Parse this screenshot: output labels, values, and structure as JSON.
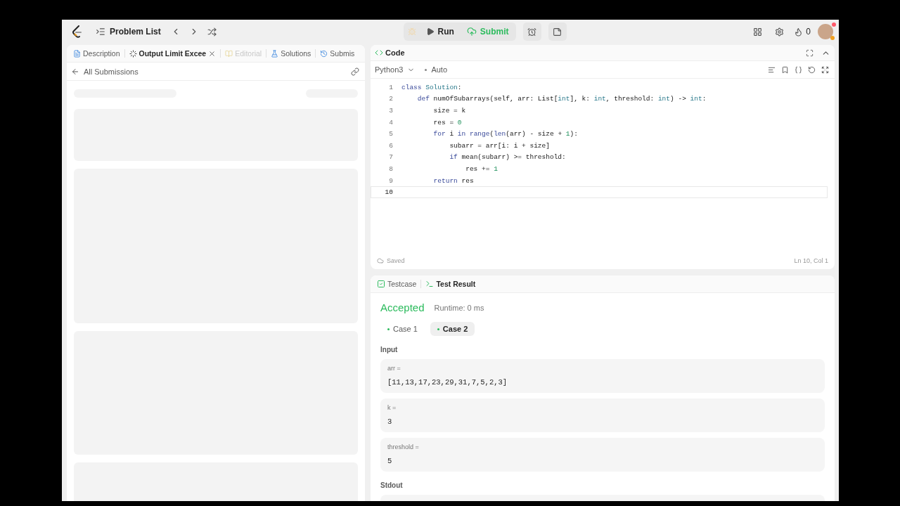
{
  "header": {
    "problem_list": "Problem List",
    "run": "Run",
    "submit": "Submit",
    "streak": "0"
  },
  "left_panel": {
    "tabs": [
      {
        "kind": "description",
        "label": "Description",
        "selected": false,
        "disabled": false,
        "closable": false
      },
      {
        "kind": "result",
        "label": "Output Limit Excee",
        "selected": true,
        "disabled": false,
        "closable": true
      },
      {
        "kind": "editorial",
        "label": "Editorial",
        "selected": false,
        "disabled": true,
        "closable": false
      },
      {
        "kind": "solutions",
        "label": "Solutions",
        "selected": false,
        "disabled": false,
        "closable": false
      },
      {
        "kind": "submissions",
        "label": "Submis",
        "selected": false,
        "disabled": false,
        "closable": false
      }
    ],
    "back_link": "All Submissions"
  },
  "code_panel": {
    "title": "Code",
    "language": "Python3",
    "mode": "Auto",
    "lines": [
      {
        "number": "1",
        "current": false,
        "tokens": [
          {
            "kind": "keyword",
            "text": "class"
          },
          {
            "kind": "type",
            "text": " Solution"
          },
          {
            "kind": "plain",
            "text": ":"
          }
        ]
      },
      {
        "number": "2",
        "current": false,
        "tokens": [
          {
            "kind": "keyword",
            "text": "    def"
          },
          {
            "kind": "plain",
            "text": " numOfSubarrays(self, arr: List["
          },
          {
            "kind": "type",
            "text": "int"
          },
          {
            "kind": "plain",
            "text": "], k: "
          },
          {
            "kind": "type",
            "text": "int"
          },
          {
            "kind": "plain",
            "text": ", threshold: "
          },
          {
            "kind": "type",
            "text": "int"
          },
          {
            "kind": "plain",
            "text": ") -> "
          },
          {
            "kind": "type",
            "text": "int"
          },
          {
            "kind": "plain",
            "text": ":"
          }
        ]
      },
      {
        "number": "3",
        "current": false,
        "tokens": [
          {
            "kind": "plain",
            "text": "        size = k"
          }
        ]
      },
      {
        "number": "4",
        "current": false,
        "tokens": [
          {
            "kind": "plain",
            "text": "        res = "
          },
          {
            "kind": "number",
            "text": "0"
          }
        ]
      },
      {
        "number": "5",
        "current": false,
        "tokens": [
          {
            "kind": "keyword",
            "text": "        for"
          },
          {
            "kind": "plain",
            "text": " i "
          },
          {
            "kind": "keyword",
            "text": "in"
          },
          {
            "kind": "builtin",
            "text": " range"
          },
          {
            "kind": "plain",
            "text": "("
          },
          {
            "kind": "builtin",
            "text": "len"
          },
          {
            "kind": "plain",
            "text": "(arr) - size + "
          },
          {
            "kind": "number",
            "text": "1"
          },
          {
            "kind": "plain",
            "text": "):"
          }
        ]
      },
      {
        "number": "6",
        "current": false,
        "tokens": [
          {
            "kind": "plain",
            "text": "            subarr = arr[i: i + size]"
          }
        ]
      },
      {
        "number": "7",
        "current": false,
        "tokens": [
          {
            "kind": "keyword",
            "text": "            if"
          },
          {
            "kind": "plain",
            "text": " mean(subarr) >= threshold:"
          }
        ]
      },
      {
        "number": "8",
        "current": false,
        "tokens": [
          {
            "kind": "plain",
            "text": "                res += "
          },
          {
            "kind": "number",
            "text": "1"
          }
        ]
      },
      {
        "number": "9",
        "current": false,
        "tokens": [
          {
            "kind": "keyword",
            "text": "        return"
          },
          {
            "kind": "plain",
            "text": " res"
          }
        ]
      },
      {
        "number": "10",
        "current": true
      }
    ],
    "status": "Saved",
    "cursor": "Ln 10, Col 1"
  },
  "result_panel": {
    "tabs": [
      {
        "kind": "testcase",
        "label": "Testcase",
        "selected": false
      },
      {
        "kind": "result",
        "label": "Test Result",
        "selected": true
      }
    ],
    "verdict": "Accepted",
    "runtime": "Runtime: 0 ms",
    "cases": [
      {
        "label": "Case 1",
        "selected": false
      },
      {
        "label": "Case 2",
        "selected": true
      }
    ],
    "input_label": "Input",
    "inputs": [
      {
        "name": "arr =",
        "value": "[11,13,17,23,29,31,7,5,2,3]"
      },
      {
        "name": "k =",
        "value": "3"
      },
      {
        "name": "threshold =",
        "value": "5"
      }
    ],
    "stdout_label": "Stdout"
  }
}
